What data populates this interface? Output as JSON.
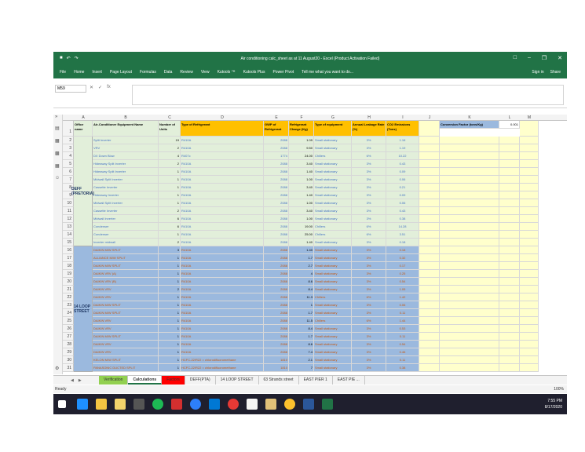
{
  "window": {
    "title": "Air conditioning  calc_sheet as at 11 August20 - Excel (Product Activation Failed)"
  },
  "ribbon": {
    "tabs": [
      "File",
      "Home",
      "Insert",
      "Page Layout",
      "Formulas",
      "Data",
      "Review",
      "View",
      "Kutools ™",
      "Kutools Plus",
      "Power Pivot"
    ],
    "tell_me": "Tell me what you want to do...",
    "sign_in": "Sign in",
    "share": "Share"
  },
  "formula_bar": {
    "name_box": "M59",
    "fx": "fx"
  },
  "columns": [
    "A",
    "B",
    "C",
    "D",
    "E",
    "F",
    "G",
    "H",
    "I",
    "J",
    "K",
    "L",
    "M"
  ],
  "headers": {
    "a": "Office name",
    "b": "Air-Conditioner Equipment Name",
    "c": "Number of Units",
    "d": "Type of Refrigerant",
    "e": "GWP of Refrigerant",
    "f": "Refrigerant Charge (Kg)",
    "g": "Type of equipment",
    "h": "Annual Leakage Rate (%)",
    "i": "CO2 Emissions (Tons)",
    "k": "Conversion Factor (tons/Kg)",
    "l": "0.001"
  },
  "offices": {
    "deff": "DEFF (PRETORIA)",
    "loop": "14 LOOP STREET"
  },
  "rows": [
    {
      "n": "2",
      "b": "Split Inverter",
      "c": "19",
      "d": "R410A",
      "e": "2088",
      "f": "1.09",
      "g": "Small stationary",
      "h": "3%",
      "i": "1.16"
    },
    {
      "n": "3",
      "b": "VRV",
      "c": "2",
      "d": "R410A",
      "e": "2088",
      "f": "9.50",
      "g": "Small stationary",
      "h": "3%",
      "i": "1.19"
    },
    {
      "n": "4",
      "b": "DX Down Blow",
      "c": "4",
      "d": "R407c",
      "e": "1774",
      "f": "24.00",
      "g": "Chillers",
      "h": "6%",
      "i": "10.22"
    },
    {
      "n": "5",
      "b": "Hideaway Split Inverter",
      "c": "2",
      "d": "R410A",
      "e": "2088",
      "f": "3.40",
      "g": "Small stationary",
      "h": "3%",
      "i": "0.43"
    },
    {
      "n": "6",
      "b": "Hideaway Split Inverter",
      "c": "1",
      "d": "R410A",
      "e": "2088",
      "f": "1.40",
      "g": "Small stationary",
      "h": "3%",
      "i": "0.09"
    },
    {
      "n": "7",
      "b": "Midwall Split Inverter",
      "c": "1",
      "d": "R410A",
      "e": "2088",
      "f": "1.00",
      "g": "Small stationary",
      "h": "3%",
      "i": "0.06"
    },
    {
      "n": "8",
      "b": "Cassette Inverter",
      "c": "1",
      "d": "R410A",
      "e": "2088",
      "f": "3.40",
      "g": "Small stationary",
      "h": "3%",
      "i": "0.21"
    },
    {
      "n": "9",
      "b": "Hideaway Inverter",
      "c": "1",
      "d": "R410A",
      "e": "2088",
      "f": "1.40",
      "g": "Small stationary",
      "h": "3%",
      "i": "0.09"
    },
    {
      "n": "10",
      "b": "Midwall Split Inverter",
      "c": "1",
      "d": "R410A",
      "e": "2088",
      "f": "1.00",
      "g": "Small stationary",
      "h": "3%",
      "i": "0.06"
    },
    {
      "n": "11",
      "b": "Cassette Inverter",
      "c": "2",
      "d": "R410A",
      "e": "2088",
      "f": "3.40",
      "g": "Small stationary",
      "h": "3%",
      "i": "0.43"
    },
    {
      "n": "12",
      "b": "Midwall Inverter",
      "c": "6",
      "d": "R410A",
      "e": "2088",
      "f": "1.00",
      "g": "Small stationary",
      "h": "3%",
      "i": "0.38"
    },
    {
      "n": "13",
      "b": "Condenser",
      "c": "6",
      "d": "R410A",
      "e": "2088",
      "f": "19.00",
      "g": "Chillers",
      "h": "6%",
      "i": "14.28"
    },
    {
      "n": "14",
      "b": "Condenser",
      "c": "1",
      "d": "R410A",
      "e": "2088",
      "f": "25.00",
      "g": "Chillers",
      "h": "6%",
      "i": "3.51"
    },
    {
      "n": "15",
      "b": "Inverter midwall",
      "c": "2",
      "d": "R410A",
      "e": "2088",
      "f": "1.40",
      "g": "Small stationary",
      "h": "3%",
      "i": "0.18"
    },
    {
      "n": "16",
      "b": "DAIKIN M/W SPLIT",
      "c": "3",
      "d": "R410A",
      "e": "2088",
      "f": "1.40",
      "g": "Small stationary",
      "h": "3%",
      "i": "0.18"
    },
    {
      "n": "17",
      "b": "ALLIANCE M/W SPLIT",
      "c": "1",
      "d": "R410A",
      "e": "2088",
      "f": "1.7",
      "g": "Small stationary",
      "h": "3%",
      "i": "0.32"
    },
    {
      "n": "18",
      "b": "DAIKIN M/W SPLIT",
      "c": "1",
      "d": "R410A",
      "e": "2088",
      "f": "2.7",
      "g": "Small stationary",
      "h": "3%",
      "i": "0.17"
    },
    {
      "n": "19",
      "b": "DAIKIN VRV (A)",
      "c": "1",
      "d": "R410A",
      "e": "2088",
      "f": "4",
      "g": "Small stationary",
      "h": "3%",
      "i": "0.25"
    },
    {
      "n": "20",
      "b": "DAIKIN VRV (B)",
      "c": "1",
      "d": "R410A",
      "e": "2088",
      "f": "8.6",
      "g": "Small stationary",
      "h": "3%",
      "i": "0.54"
    },
    {
      "n": "21",
      "b": "DAIKIN VRV",
      "c": "2",
      "d": "R410A",
      "e": "2088",
      "f": "8.4",
      "g": "Small stationary",
      "h": "3%",
      "i": "1.05"
    },
    {
      "n": "22",
      "b": "DAIKIN VRV",
      "c": "1",
      "d": "R410A",
      "e": "2088",
      "f": "11.3",
      "g": "Chillers",
      "h": "6%",
      "i": "1.42"
    },
    {
      "n": "23",
      "b": "DAIKIN M/W SPLIT",
      "c": "1",
      "d": "R410A",
      "e": "2088",
      "f": "1",
      "g": "Small stationary",
      "h": "3%",
      "i": "0.06"
    },
    {
      "n": "24",
      "b": "DAIKIN M/W SPLIT",
      "c": "1",
      "d": "R410A",
      "e": "2088",
      "f": "1.7",
      "g": "Small stationary",
      "h": "3%",
      "i": "0.11"
    },
    {
      "n": "25",
      "b": "DAIKIN VRV",
      "c": "1",
      "d": "R410A",
      "e": "2088",
      "f": "11.5",
      "g": "Chillers",
      "h": "6%",
      "i": "1.44"
    },
    {
      "n": "26",
      "b": "DAIKIN VRV",
      "c": "1",
      "d": "R410A",
      "e": "2088",
      "f": "8.4",
      "g": "Small stationary",
      "h": "3%",
      "i": "0.53"
    },
    {
      "n": "27",
      "b": "DAIKIN M/W SPLIT",
      "c": "1",
      "d": "R410A",
      "e": "2088",
      "f": "1.7",
      "g": "Small stationary",
      "h": "3%",
      "i": "0.11"
    },
    {
      "n": "28",
      "b": "DAIKIN VRV",
      "c": "1",
      "d": "R410A",
      "e": "2088",
      "f": "8.6",
      "g": "Small stationary",
      "h": "3%",
      "i": "0.54"
    },
    {
      "n": "29",
      "b": "DAIKIN VRV",
      "c": "1",
      "d": "R410A",
      "e": "2088",
      "f": "7.4",
      "g": "Small stationary",
      "h": "3%",
      "i": "0.46"
    },
    {
      "n": "30",
      "b": "KELON M/W SPLIT",
      "c": "1",
      "d": "HCFC-22/R22 = chlorodifluoromethane",
      "e": "1810",
      "f": "2.1",
      "g": "Small stationary",
      "h": "3%",
      "i": "0.11"
    },
    {
      "n": "31",
      "b": "PANASONIC DUCTED SPLIT",
      "c": "1",
      "d": "HCFC-22/R22 = chlorodifluoromethane",
      "e": "1810",
      "f": "7",
      "g": "Small stationary",
      "h": "3%",
      "i": "0.38"
    }
  ],
  "sheet_tabs": [
    "Verification",
    "Calculations",
    "Factors",
    "DEFF(PTA)",
    "14 LOOP STREET",
    "63 Strands street",
    "EAST PIER 1",
    "EAST PIE ..."
  ],
  "status": {
    "left": "Ready",
    "zoom": "100%"
  },
  "clock": {
    "time": "7:55 PM",
    "date": "8/17/2020"
  },
  "colors": {
    "excel_green": "#217346",
    "office_a": "#e2efda",
    "office_b": "#9bb9de",
    "header_orange": "#ffc000"
  }
}
